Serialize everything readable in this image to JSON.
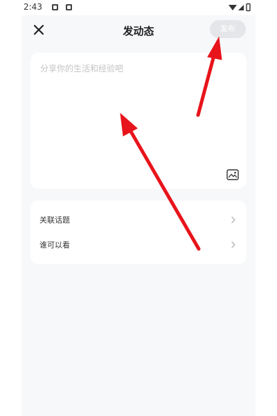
{
  "status_bar": {
    "time": "2:43"
  },
  "header": {
    "title": "发动态",
    "publish_label": "发布"
  },
  "editor": {
    "placeholder": "分享你的生活和经验吧"
  },
  "options": [
    {
      "label": "关联话题"
    },
    {
      "label": "谁可以看"
    }
  ],
  "colors": {
    "annotation_arrow": "#e8141b",
    "page_background": "#f7f8fa",
    "publish_disabled": "#e5e6e9"
  }
}
